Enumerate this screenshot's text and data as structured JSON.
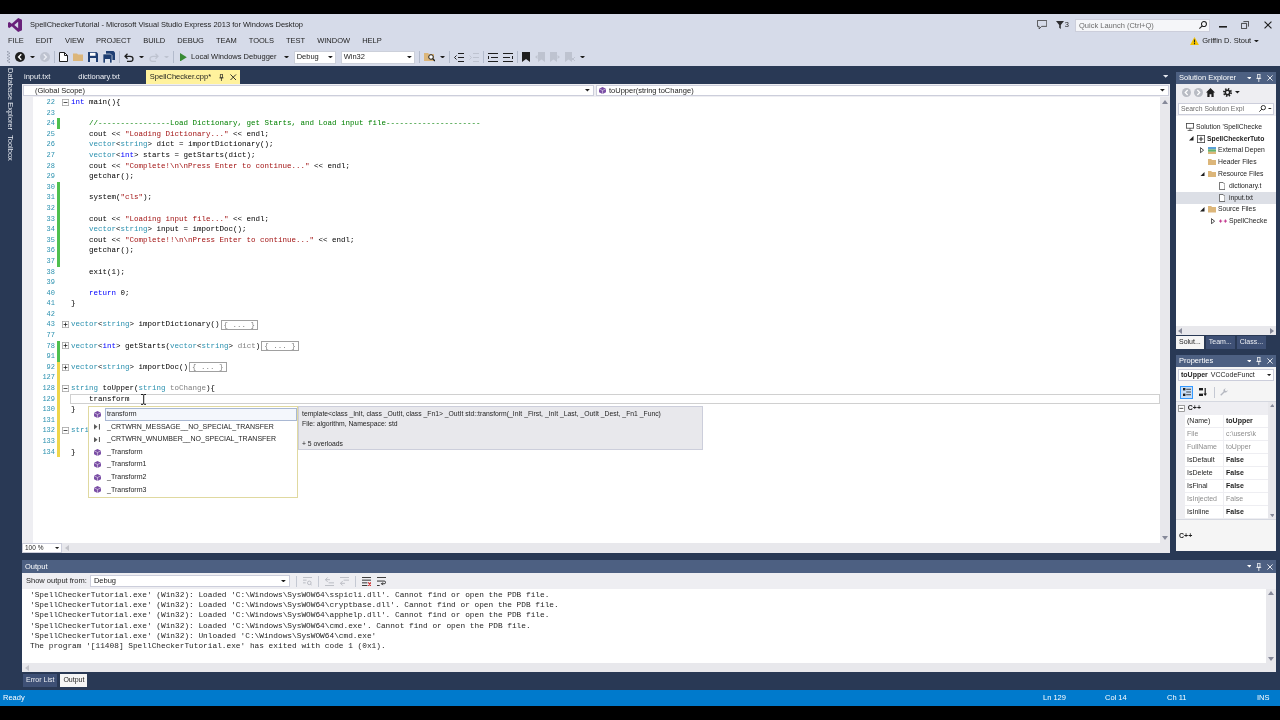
{
  "window": {
    "title": "SpellCheckerTutorial - Microsoft Visual Studio Express 2013 for Windows Desktop",
    "notifications": "3",
    "quick_launch": {
      "placeholder": "Quick Launch (Ctrl+Q)"
    },
    "user": "Griffin D. Stout"
  },
  "menu": [
    "FILE",
    "EDIT",
    "VIEW",
    "PROJECT",
    "BUILD",
    "DEBUG",
    "TEAM",
    "TOOLS",
    "TEST",
    "WINDOW",
    "HELP"
  ],
  "toolbar": {
    "groups": [
      [
        {
          "kind": "back",
          "disabled": false
        },
        {
          "kind": "menu",
          "disabled": false
        },
        {
          "kind": "forward",
          "disabled": true
        }
      ],
      [
        {
          "kind": "new",
          "disabled": false
        },
        {
          "kind": "open",
          "disabled": false
        },
        {
          "kind": "save",
          "disabled": false
        },
        {
          "kind": "save-all",
          "disabled": false
        }
      ],
      [
        {
          "kind": "undo",
          "disabled": false
        },
        {
          "kind": "menu",
          "disabled": false
        },
        {
          "kind": "redo",
          "disabled": true
        },
        {
          "kind": "menu",
          "disabled": true
        }
      ],
      [
        {
          "kind": "start",
          "label": "Local Windows Debugger"
        },
        {
          "kind": "menu",
          "disabled": false
        },
        {
          "kind": "configuration",
          "value": "Debug"
        },
        {
          "kind": "platform",
          "value": "Win32"
        }
      ],
      [
        {
          "kind": "find",
          "disabled": false
        },
        {
          "kind": "menu",
          "disabled": false
        }
      ],
      [
        {
          "kind": "outdent",
          "disabled": false
        },
        {
          "kind": "indent",
          "disabled": true
        }
      ],
      [
        {
          "kind": "comment",
          "disabled": false
        },
        {
          "kind": "uncomment",
          "disabled": false
        }
      ],
      [
        {
          "kind": "bookmark",
          "disabled": false
        },
        {
          "kind": "bookmark-prev",
          "disabled": true
        },
        {
          "kind": "bookmark-next",
          "disabled": true
        },
        {
          "kind": "bookmark-clear",
          "disabled": true
        },
        {
          "kind": "menu",
          "disabled": false
        }
      ]
    ]
  },
  "side_tabs": [
    "Database Explorer",
    "Toolbox"
  ],
  "documents": {
    "tabs": [
      {
        "label": "input.txt",
        "selected": false
      },
      {
        "label": "dictionary.txt",
        "selected": false
      },
      {
        "label": "SpellChecker.cpp*",
        "selected": true
      }
    ]
  },
  "navigation": {
    "scope": "(Global Scope)",
    "member": "toUpper(string toChange)"
  },
  "editor": {
    "lines": [
      {
        "number": "22",
        "expanded": true,
        "current": false,
        "tokens": [
          {
            "kind": "keyword",
            "text": "int"
          },
          {
            "kind": "plain",
            "text": " main(){"
          }
        ],
        "children": [
          {
            "number": "23",
            "current": false
          },
          {
            "number": "24",
            "color": "#4fbf4f",
            "current": false,
            "tokens": [
              {
                "kind": "comment",
                "text": "//----------------Load Dictionary, get Starts, and Load input file---------------------"
              }
            ]
          },
          {
            "number": "25",
            "current": false,
            "tokens": [
              {
                "kind": "plain",
                "text": "cout << "
              },
              {
                "kind": "string",
                "text": "\"Loading Dictionary...\""
              },
              {
                "kind": "plain",
                "text": " << endl;"
              }
            ]
          },
          {
            "number": "26",
            "current": false,
            "tokens": [
              {
                "kind": "type",
                "text": "vector"
              },
              {
                "kind": "plain",
                "text": "<"
              },
              {
                "kind": "type",
                "text": "string"
              },
              {
                "kind": "plain",
                "text": "> dict = importDictionary();"
              }
            ]
          },
          {
            "number": "27",
            "current": false,
            "tokens": [
              {
                "kind": "type",
                "text": "vector"
              },
              {
                "kind": "plain",
                "text": "<"
              },
              {
                "kind": "keyword",
                "text": "int"
              },
              {
                "kind": "plain",
                "text": "> starts = getStarts(dict);"
              }
            ]
          },
          {
            "number": "28",
            "current": false,
            "tokens": [
              {
                "kind": "plain",
                "text": "cout << "
              },
              {
                "kind": "string",
                "text": "\"Complete!\\n\\nPress Enter to continue...\""
              },
              {
                "kind": "plain",
                "text": " << endl;"
              }
            ]
          },
          {
            "number": "29",
            "current": false,
            "tokens": [
              {
                "kind": "plain",
                "text": "getchar();"
              }
            ]
          },
          {
            "number": "30",
            "color": "#4fbf4f",
            "current": false
          },
          {
            "number": "31",
            "color": "#4fbf4f",
            "current": false,
            "tokens": [
              {
                "kind": "plain",
                "text": "system("
              },
              {
                "kind": "string",
                "text": "\"cls\""
              },
              {
                "kind": "plain",
                "text": ");"
              }
            ]
          },
          {
            "number": "32",
            "color": "#4fbf4f",
            "current": false
          },
          {
            "number": "33",
            "color": "#4fbf4f",
            "current": false,
            "tokens": [
              {
                "kind": "plain",
                "text": "cout << "
              },
              {
                "kind": "string",
                "text": "\"Loading input file...\""
              },
              {
                "kind": "plain",
                "text": " << endl;"
              }
            ]
          },
          {
            "number": "34",
            "color": "#4fbf4f",
            "current": false,
            "tokens": [
              {
                "kind": "type",
                "text": "vector"
              },
              {
                "kind": "plain",
                "text": "<"
              },
              {
                "kind": "type",
                "text": "string"
              },
              {
                "kind": "plain",
                "text": "> input = importDoc();"
              }
            ]
          },
          {
            "number": "35",
            "color": "#4fbf4f",
            "current": false,
            "tokens": [
              {
                "kind": "plain",
                "text": "cout << "
              },
              {
                "kind": "string",
                "text": "\"Complete!!\\n\\nPress Enter to continue...\""
              },
              {
                "kind": "plain",
                "text": " << endl;"
              }
            ]
          },
          {
            "number": "36",
            "color": "#4fbf4f",
            "current": false,
            "tokens": [
              {
                "kind": "plain",
                "text": "getchar();"
              }
            ]
          },
          {
            "number": "37",
            "color": "#4fbf4f",
            "current": false
          },
          {
            "number": "38",
            "current": false,
            "tokens": [
              {
                "kind": "plain",
                "text": "exit(1);"
              }
            ]
          },
          {
            "number": "39",
            "current": false
          },
          {
            "number": "40",
            "current": false,
            "tokens": [
              {
                "kind": "keyword",
                "text": "return"
              },
              {
                "kind": "plain",
                "text": " 0;"
              }
            ]
          }
        ]
      },
      {
        "number": "41",
        "current": false,
        "tokens": [
          {
            "kind": "plain",
            "text": "}"
          }
        ]
      },
      {
        "number": "42",
        "current": false
      },
      {
        "number": "43",
        "expanded": false,
        "current": false,
        "tokens": [
          {
            "kind": "type",
            "text": "vector"
          },
          {
            "kind": "plain",
            "text": "<"
          },
          {
            "kind": "type",
            "text": "string"
          },
          {
            "kind": "plain",
            "text": "> importDictionary()"
          },
          {
            "kind": "collapsed",
            "text": "{ ... }"
          }
        ]
      },
      {
        "number": "77",
        "current": false
      },
      {
        "number": "78",
        "expanded": false,
        "color": "#4fbf4f",
        "current": false,
        "tokens": [
          {
            "kind": "type",
            "text": "vector"
          },
          {
            "kind": "plain",
            "text": "<"
          },
          {
            "kind": "keyword",
            "text": "int"
          },
          {
            "kind": "plain",
            "text": "> getStarts("
          },
          {
            "kind": "type",
            "text": "vector"
          },
          {
            "kind": "plain",
            "text": "<"
          },
          {
            "kind": "type",
            "text": "string"
          },
          {
            "kind": "plain",
            "text": "> "
          },
          {
            "kind": "param",
            "text": "dict"
          },
          {
            "kind": "plain",
            "text": ")"
          },
          {
            "kind": "collapsed",
            "text": "{ ... }"
          }
        ]
      },
      {
        "number": "91",
        "color": "#4fbf4f",
        "current": false
      },
      {
        "number": "92",
        "expanded": false,
        "color": "#efd54a",
        "current": false,
        "tokens": [
          {
            "kind": "type",
            "text": "vector"
          },
          {
            "kind": "plain",
            "text": "<"
          },
          {
            "kind": "type",
            "text": "string"
          },
          {
            "kind": "plain",
            "text": "> importDoc()"
          },
          {
            "kind": "collapsed",
            "text": "{ ... }"
          }
        ]
      },
      {
        "number": "127",
        "color": "#efd54a",
        "current": false
      },
      {
        "number": "128",
        "expanded": true,
        "color": "#efd54a",
        "current": false,
        "tokens": [
          {
            "kind": "type",
            "text": "string"
          },
          {
            "kind": "plain",
            "text": " toUpper("
          },
          {
            "kind": "type",
            "text": "string"
          },
          {
            "kind": "param",
            "text": " toChange"
          },
          {
            "kind": "plain",
            "text": "){"
          }
        ],
        "children": [
          {
            "number": "129",
            "color": "#efd54a",
            "current": true,
            "tokens": [
              {
                "kind": "plain",
                "text": "transform"
              }
            ]
          }
        ]
      },
      {
        "number": "130",
        "color": "#efd54a",
        "current": false,
        "tokens": [
          {
            "kind": "plain",
            "text": "}"
          }
        ]
      },
      {
        "number": "131",
        "color": "#efd54a",
        "current": false
      },
      {
        "number": "132",
        "expanded": true,
        "color": "#efd54a",
        "current": false,
        "tokens": [
          {
            "kind": "type",
            "text": "stri"
          }
        ]
      },
      {
        "number": "133",
        "color": "#efd54a",
        "current": false
      },
      {
        "number": "134",
        "color": "#efd54a",
        "current": false,
        "tokens": [
          {
            "kind": "plain",
            "text": "}"
          }
        ]
      }
    ],
    "zoom": "100 %",
    "completion": {
      "items": [
        {
          "label": "transform",
          "kind": "function",
          "selected": true
        },
        {
          "label": "_CRTWRN_MESSAGE__NO_SPECIAL_TRANSFER",
          "kind": "macro",
          "selected": false
        },
        {
          "label": "_CRTWRN_WNUMBER__NO_SPECIAL_TRANSFER",
          "kind": "macro",
          "selected": false
        },
        {
          "label": "_Transform",
          "kind": "function",
          "selected": false
        },
        {
          "label": "_Transform1",
          "kind": "function",
          "selected": false
        },
        {
          "label": "_Transform2",
          "kind": "function",
          "selected": false
        },
        {
          "label": "_Transform3",
          "kind": "function",
          "selected": false
        }
      ],
      "tooltip": {
        "signature": "template<class _InIt, class _OutIt, class _Fn1> _OutIt std::transform(_InIt _First, _InIt _Last, _OutIt _Dest, _Fn1 _Func)",
        "location": "File: algorithm, Namespace: std",
        "overloads": "+ 5 overloads"
      }
    }
  },
  "solution_explorer": {
    "title": "Solution Explorer",
    "toolbar": [
      {
        "kind": "back",
        "disabled": true
      },
      {
        "kind": "forward",
        "disabled": true
      },
      {
        "kind": "home",
        "disabled": false
      },
      {
        "kind": "settings",
        "disabled": false
      },
      {
        "kind": "menu",
        "disabled": false
      }
    ],
    "search": {
      "placeholder": "Search Solution Expl"
    },
    "tree": [
      {
        "label": "Solution 'SpellChecke",
        "kind": "solution",
        "selected": false,
        "children": [
          {
            "label": "SpellCheckerTuto",
            "kind": "project",
            "expanded": true,
            "selected": false,
            "children": [
              {
                "label": "External Depen",
                "kind": "references",
                "expanded": false,
                "selected": false
              },
              {
                "label": "Header Files",
                "kind": "folder",
                "selected": false
              },
              {
                "label": "Resource Files",
                "kind": "folder",
                "expanded": true,
                "selected": false,
                "children": [
                  {
                    "label": "dictionary.t",
                    "kind": "file",
                    "selected": false
                  },
                  {
                    "label": "input.txt",
                    "kind": "file",
                    "selected": true
                  }
                ]
              },
              {
                "label": "Source Files",
                "kind": "folder",
                "expanded": true,
                "selected": false,
                "children": [
                  {
                    "label": "SpellChecke",
                    "kind": "cpp",
                    "expanded": false,
                    "selected": false
                  }
                ]
              }
            ]
          }
        ]
      }
    ],
    "tabs": [
      {
        "label": "Solut...",
        "selected": true
      },
      {
        "label": "Team...",
        "selected": false
      },
      {
        "label": "Class...",
        "selected": false
      }
    ]
  },
  "properties": {
    "title": "Properties",
    "object": {
      "name": "toUpper",
      "type": "VCCodeFunct"
    },
    "sort_buttons": [
      {
        "kind": "categorized",
        "selected": true
      },
      {
        "kind": "alphabetical",
        "selected": false
      }
    ],
    "pages_button": {
      "disabled": true
    },
    "category": {
      "label": "C++",
      "expanded": true
    },
    "rows": [
      {
        "name": "(Name)",
        "value": "toUpper",
        "readonly": false
      },
      {
        "name": "File",
        "value": "c:\\users\\k",
        "readonly": true
      },
      {
        "name": "FullName",
        "value": "toUpper",
        "readonly": true
      },
      {
        "name": "IsDefault",
        "value": "False",
        "readonly": false
      },
      {
        "name": "IsDelete",
        "value": "False",
        "readonly": false
      },
      {
        "name": "IsFinal",
        "value": "False",
        "readonly": false
      },
      {
        "name": "IsInjected",
        "value": "False",
        "readonly": true
      },
      {
        "name": "IsInline",
        "value": "False",
        "readonly": false
      }
    ],
    "description": "C++"
  },
  "output": {
    "title": "Output",
    "source_label": "Show output from:",
    "source": "Debug",
    "toolbar": [
      [
        {
          "kind": "find-source",
          "disabled": true
        }
      ],
      [
        {
          "kind": "previous",
          "disabled": true
        },
        {
          "kind": "next",
          "disabled": true
        }
      ],
      [
        {
          "kind": "clear",
          "disabled": false
        },
        {
          "kind": "word-wrap",
          "disabled": false
        }
      ]
    ],
    "lines": [
      "'SpellCheckerTutorial.exe' (Win32): Loaded 'C:\\Windows\\SysWOW64\\sspicli.dll'. Cannot find or open the PDB file.",
      "'SpellCheckerTutorial.exe' (Win32): Loaded 'C:\\Windows\\SysWOW64\\cryptbase.dll'. Cannot find or open the PDB file.",
      "'SpellCheckerTutorial.exe' (Win32): Loaded 'C:\\Windows\\SysWOW64\\apphelp.dll'. Cannot find or open the PDB file.",
      "'SpellCheckerTutorial.exe' (Win32): Loaded 'C:\\Windows\\SysWOW64\\cmd.exe'. Cannot find or open the PDB file.",
      "'SpellCheckerTutorial.exe' (Win32): Unloaded 'C:\\Windows\\SysWOW64\\cmd.exe'",
      "The program '[11408] SpellCheckerTutorial.exe' has exited with code 1 (0x1)."
    ],
    "tabs": [
      {
        "label": "Error List",
        "selected": false
      },
      {
        "label": "Output",
        "selected": true
      }
    ]
  },
  "status_bar": {
    "message": "Ready",
    "line": "Ln 129",
    "column": "Col 14",
    "character": "Ch 11",
    "mode": "INS"
  }
}
